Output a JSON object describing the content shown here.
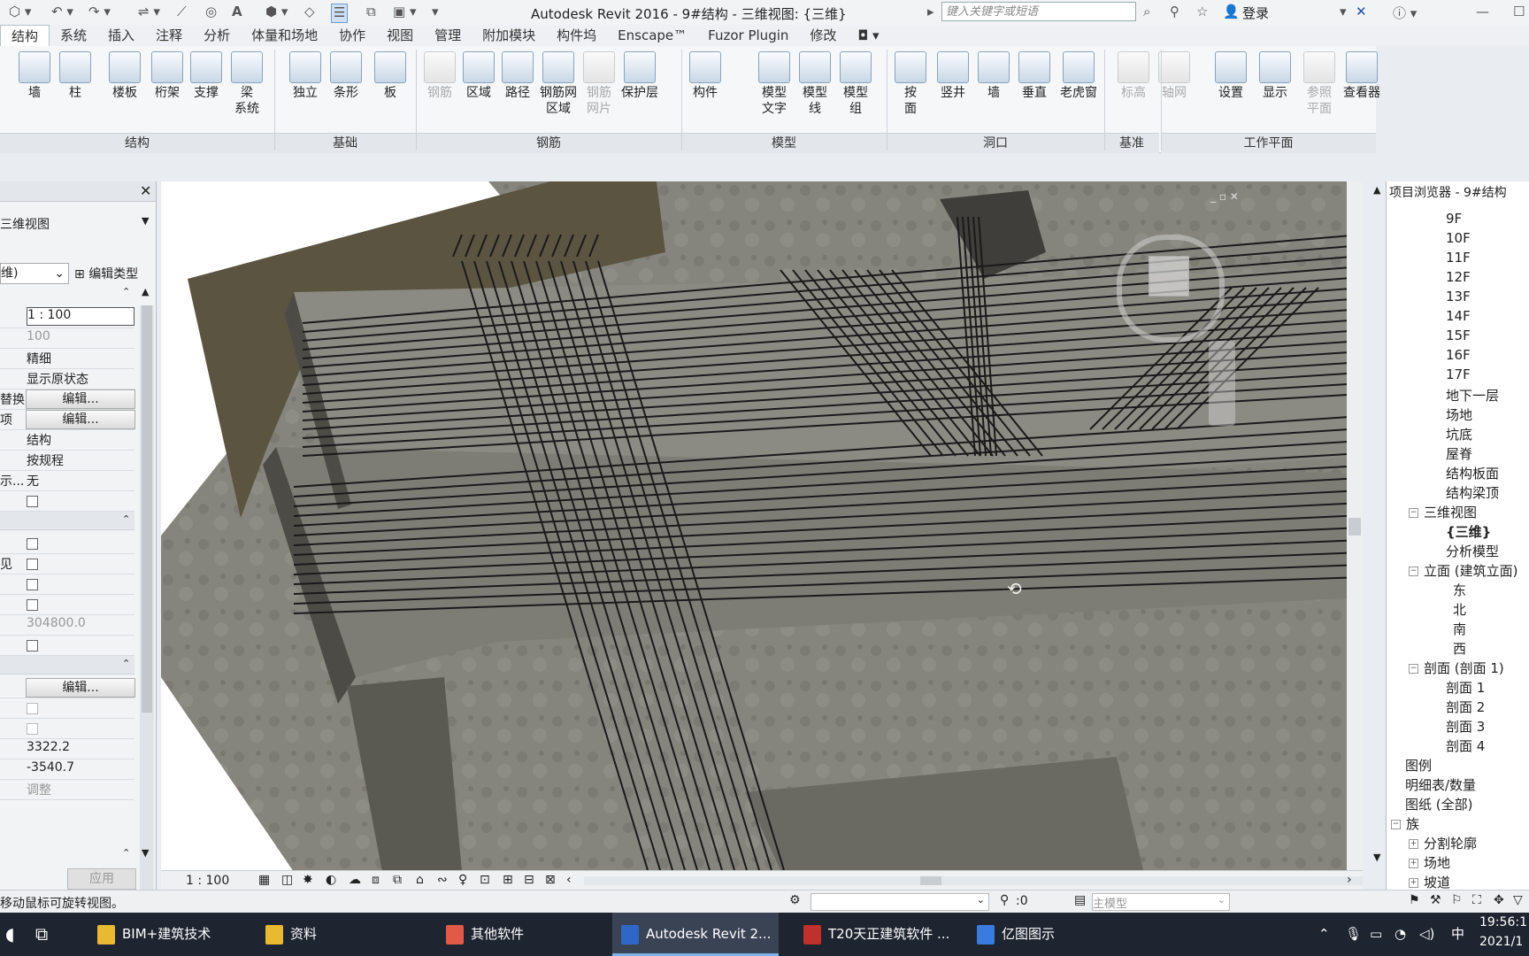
{
  "titlebar": {
    "title": "Autodesk Revit 2016 -    9#结构 - 三维视图: {三维}",
    "search_placeholder": "键入关键字或短语",
    "login": "登录"
  },
  "tabs": [
    "结构",
    "系统",
    "插入",
    "注释",
    "分析",
    "体量和场地",
    "协作",
    "视图",
    "管理",
    "附加模块",
    "构件坞",
    "Enscape™",
    "Fuzor Plugin",
    "修改"
  ],
  "ribbon": {
    "tools": [
      {
        "l1": "墙",
        "l2": ""
      },
      {
        "l1": "柱",
        "l2": ""
      },
      {
        "l1": "楼板",
        "l2": ""
      },
      {
        "l1": "桁架",
        "l2": ""
      },
      {
        "l1": "支撑",
        "l2": ""
      },
      {
        "l1": "梁",
        "l2": "系统"
      },
      {
        "l1": "独立",
        "l2": ""
      },
      {
        "l1": "条形",
        "l2": ""
      },
      {
        "l1": "板",
        "l2": ""
      },
      {
        "l1": "钢筋",
        "l2": ""
      },
      {
        "l1": "区域",
        "l2": ""
      },
      {
        "l1": "路径",
        "l2": ""
      },
      {
        "l1": "钢筋网",
        "l2": "区域"
      },
      {
        "l1": "钢筋",
        "l2": "网片"
      },
      {
        "l1": "保护层",
        "l2": ""
      },
      {
        "l1": "构件",
        "l2": ""
      },
      {
        "l1": "模型",
        "l2": "文字"
      },
      {
        "l1": "模型",
        "l2": "线"
      },
      {
        "l1": "模型",
        "l2": "组"
      },
      {
        "l1": "按",
        "l2": "面"
      },
      {
        "l1": "竖井",
        "l2": ""
      },
      {
        "l1": "墙",
        "l2": ""
      },
      {
        "l1": "垂直",
        "l2": ""
      },
      {
        "l1": "老虎窗",
        "l2": ""
      },
      {
        "l1": "标高",
        "l2": ""
      },
      {
        "l1": "轴网",
        "l2": ""
      },
      {
        "l1": "设置",
        "l2": ""
      },
      {
        "l1": "显示",
        "l2": ""
      },
      {
        "l1": "参照",
        "l2": "平面"
      },
      {
        "l1": "查看器",
        "l2": ""
      }
    ],
    "panels": [
      "结构",
      "基础",
      "钢筋",
      "模型",
      "洞口",
      "基准",
      "工作平面"
    ]
  },
  "properties": {
    "view_type": "三维视图",
    "type_selector": "维)",
    "edit_type": "编辑类型",
    "scale": "1 : 100",
    "scale_value": "100",
    "detail_level": "精细",
    "parts_visibility": "显示原状态",
    "k_overrides": "替换",
    "k_graphics": "项",
    "edit": "编辑...",
    "discipline": "结构",
    "color_scheme": "按规程",
    "k_default": "示...",
    "default_analysis": "无",
    "k_visible": "见",
    "eye_elevation": "304800.0",
    "e1": "3322.2",
    "e2": "-3540.7",
    "adjust": "调整",
    "apply": "应用"
  },
  "browser": {
    "title": "项目浏览器 - 9#结构",
    "items": [
      "9F",
      "10F",
      "11F",
      "12F",
      "13F",
      "14F",
      "15F",
      "16F",
      "17F",
      "地下一层",
      "场地",
      "坑底",
      "屋脊",
      "结构板面",
      "结构梁顶"
    ],
    "view3d_group": "三维视图",
    "view3d_items": [
      "{三维}",
      "分析模型"
    ],
    "elev_group": "立面 (建筑立面)",
    "elev_items": [
      "东",
      "北",
      "南",
      "西"
    ],
    "section_group": "剖面 (剖面 1)",
    "section_items": [
      "剖面 1",
      "剖面 2",
      "剖面 3",
      "剖面 4"
    ],
    "others": [
      "图例",
      "明细表/数量",
      "图纸 (全部)"
    ],
    "families": "族",
    "family_items": [
      "分割轮廓",
      "场地",
      "坡道"
    ]
  },
  "viewbar": {
    "scale": "1 : 100"
  },
  "status": {
    "hint": "移动鼠标可旋转视图。",
    "selection": ":0",
    "model": "主模型"
  },
  "taskbar": {
    "items": [
      "BIM+建筑技术",
      "资料",
      "其他软件",
      "Autodesk Revit 2...",
      "T20天正建筑软件 ...",
      "亿图图示"
    ],
    "lang": "中",
    "time": "19:56:1",
    "date": "2021/1"
  },
  "colors": {
    "accent": "#2b6cb0",
    "viewport": "#808078",
    "rebar": "#1a1a1a",
    "slab": "#7a786f"
  }
}
